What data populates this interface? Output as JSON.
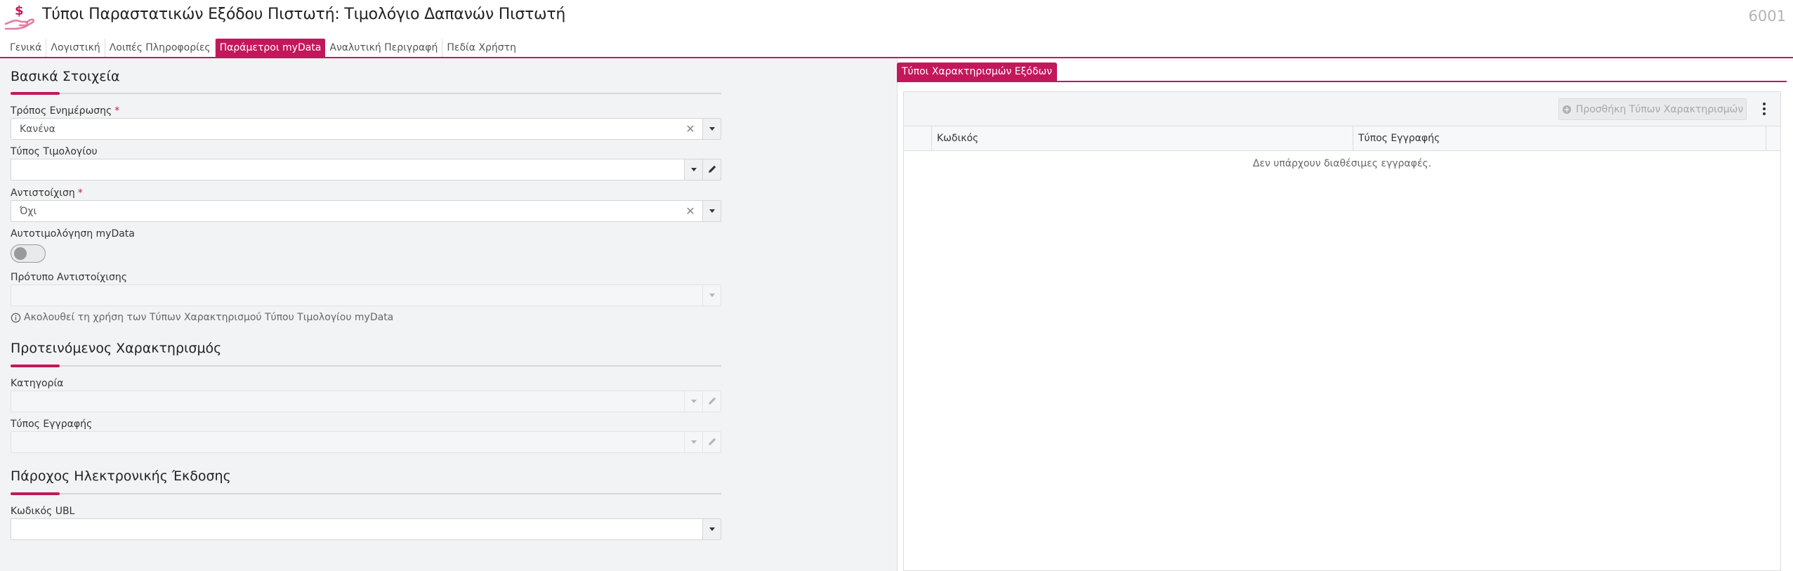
{
  "header": {
    "title": "Τύποι Παραστατικών Εξόδου Πιστωτή: Τιμολόγιο Δαπανών Πιστωτή",
    "record_id": "6001",
    "logo_icon": "hand-dollar-icon"
  },
  "tabs": [
    {
      "label": "Γενικά",
      "active": false
    },
    {
      "label": "Λογιστική",
      "active": false
    },
    {
      "label": "Λοιπές Πληροφορίες",
      "active": false
    },
    {
      "label": "Παράμετροι myData",
      "active": true
    },
    {
      "label": "Αναλυτική Περιγραφή",
      "active": false
    },
    {
      "label": "Πεδία Χρήστη",
      "active": false
    }
  ],
  "basic": {
    "title": "Βασικά Στοιχεία",
    "update_mode": {
      "label": "Τρόπος Ενημέρωσης",
      "required": "*",
      "value": "Κανένα"
    },
    "invoice_type": {
      "label": "Τύπος Τιμολογίου",
      "value": ""
    },
    "mapping": {
      "label": "Αντιστοίχιση",
      "required": "*",
      "value": "Όχι"
    },
    "auto_invoicing": {
      "label": "Αυτοτιμολόγηση myData",
      "on": false
    },
    "mapping_template": {
      "label": "Πρότυπο Αντιστοίχισης",
      "value": ""
    },
    "note": "Ακολουθεί τη χρήση των Τύπων Χαρακτηρισμού Τύπου Τιμολογίου myData"
  },
  "suggested": {
    "title": "Προτεινόμενος Χαρακτηρισμός",
    "category": {
      "label": "Κατηγορία",
      "value": ""
    },
    "record_type": {
      "label": "Τύπος Εγγραφής",
      "value": ""
    }
  },
  "provider": {
    "title": "Πάροχος Ηλεκτρονικής Έκδοσης",
    "ubl_code": {
      "label": "Κωδικός UBL",
      "value": ""
    }
  },
  "right": {
    "tab_label": "Τύποι Χαρακτηρισμών Εξόδων",
    "add_button": "Προσθήκη Τύπων Χαρακτηρισμών",
    "columns": [
      "Κωδικός",
      "Τύπος Εγγραφής"
    ],
    "empty_message": "Δεν υπάρχουν διαθέσιμες εγγραφές."
  },
  "colors": {
    "accent": "#c2185b",
    "panel_bg": "#f2f3f5"
  }
}
